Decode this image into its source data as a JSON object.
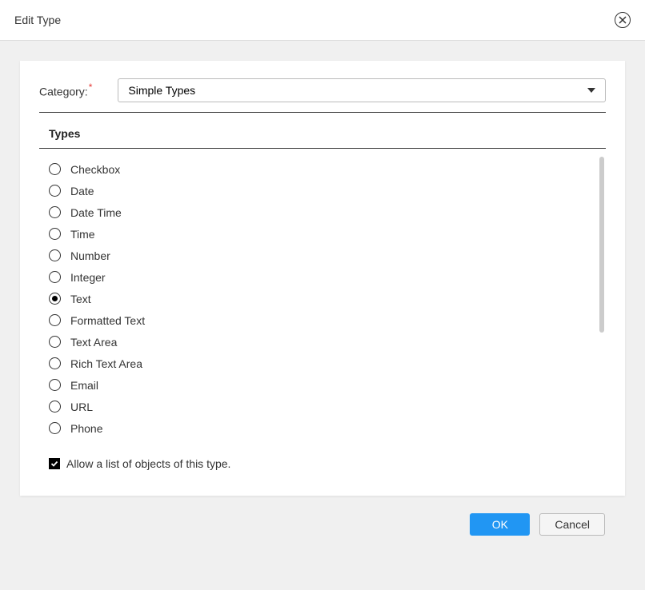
{
  "dialog": {
    "title": "Edit Type"
  },
  "category": {
    "label": "Category:",
    "required": "*",
    "selected": "Simple Types"
  },
  "types": {
    "header": "Types",
    "options": [
      {
        "label": "Checkbox",
        "checked": false
      },
      {
        "label": "Date",
        "checked": false
      },
      {
        "label": "Date Time",
        "checked": false
      },
      {
        "label": "Time",
        "checked": false
      },
      {
        "label": "Number",
        "checked": false
      },
      {
        "label": "Integer",
        "checked": false
      },
      {
        "label": "Text",
        "checked": true
      },
      {
        "label": "Formatted Text",
        "checked": false
      },
      {
        "label": "Text Area",
        "checked": false
      },
      {
        "label": "Rich Text Area",
        "checked": false
      },
      {
        "label": "Email",
        "checked": false
      },
      {
        "label": "URL",
        "checked": false
      },
      {
        "label": "Phone",
        "checked": false
      }
    ]
  },
  "allowList": {
    "label": "Allow a list of objects of this type.",
    "checked": true
  },
  "buttons": {
    "ok": "OK",
    "cancel": "Cancel"
  }
}
